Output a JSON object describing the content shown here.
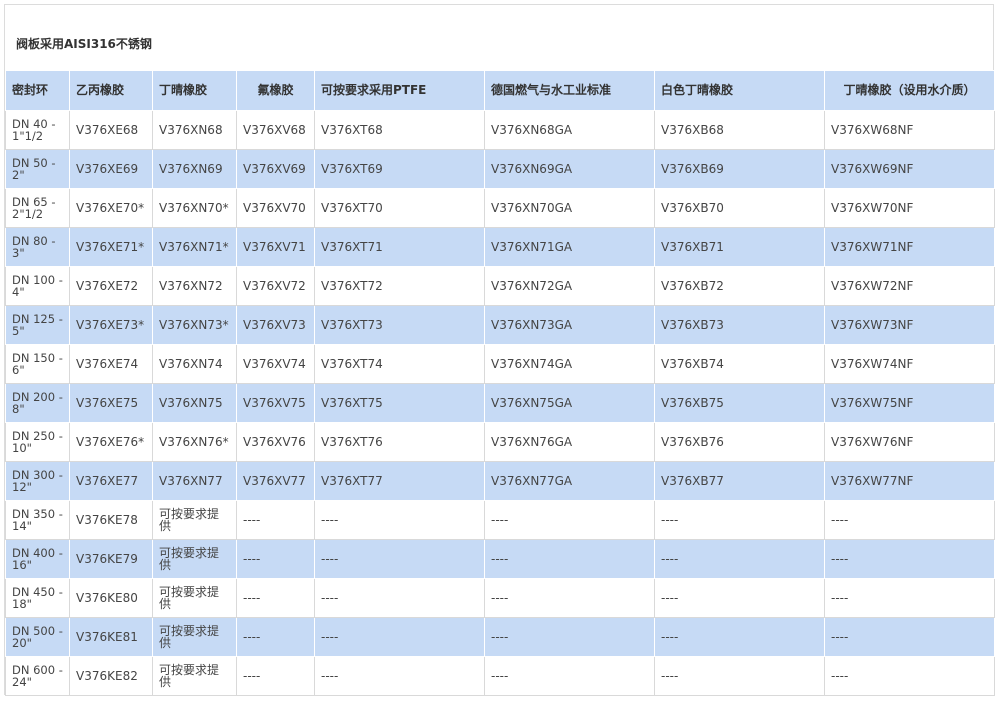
{
  "caption": "阀板采用AISI316不锈钢",
  "table": {
    "headers": [
      "密封环",
      "乙丙橡胶",
      "丁晴橡胶",
      "氟橡胶",
      "可按要求采用PTFE",
      "德国燃气与水工业标准",
      "白色丁晴橡胶",
      "丁晴橡胶（设用水介质）"
    ],
    "rows": [
      [
        "DN 40 - 1\"1/2",
        "V376XE68",
        "V376XN68",
        "V376XV68",
        "V376XT68",
        "V376XN68GA",
        "V376XB68",
        "V376XW68NF"
      ],
      [
        "DN 50 - 2\"",
        "V376XE69",
        "V376XN69",
        "V376XV69",
        "V376XT69",
        "V376XN69GA",
        "V376XB69",
        "V376XW69NF"
      ],
      [
        "DN 65 - 2\"1/2",
        "V376XE70*",
        "V376XN70*",
        "V376XV70",
        "V376XT70",
        "V376XN70GA",
        "V376XB70",
        "V376XW70NF"
      ],
      [
        "DN 80 - 3\"",
        "V376XE71*",
        "V376XN71*",
        "V376XV71",
        "V376XT71",
        "V376XN71GA",
        "V376XB71",
        "V376XW71NF"
      ],
      [
        "DN 100 - 4\"",
        "V376XE72",
        "V376XN72",
        "V376XV72",
        "V376XT72",
        "V376XN72GA",
        "V376XB72",
        "V376XW72NF"
      ],
      [
        "DN 125 - 5\"",
        "V376XE73*",
        "V376XN73*",
        "V376XV73",
        "V376XT73",
        "V376XN73GA",
        "V376XB73",
        "V376XW73NF"
      ],
      [
        "DN 150 - 6\"",
        "V376XE74",
        "V376XN74",
        "V376XV74",
        "V376XT74",
        "V376XN74GA",
        "V376XB74",
        "V376XW74NF"
      ],
      [
        "DN 200 - 8\"",
        "V376XE75",
        "V376XN75",
        "V376XV75",
        "V376XT75",
        "V376XN75GA",
        "V376XB75",
        "V376XW75NF"
      ],
      [
        "DN 250 - 10\"",
        "V376XE76*",
        "V376XN76*",
        "V376XV76",
        "V376XT76",
        "V376XN76GA",
        "V376XB76",
        "V376XW76NF"
      ],
      [
        "DN 300 - 12\"",
        "V376XE77",
        "V376XN77",
        "V376XV77",
        "V376XT77",
        "V376XN77GA",
        "V376XB77",
        "V376XW77NF"
      ],
      [
        "DN 350 - 14\"",
        "V376KE78",
        "可按要求提供",
        "----",
        "----",
        "----",
        "----",
        "----"
      ],
      [
        "DN 400 - 16\"",
        "V376KE79",
        "可按要求提供",
        "----",
        "----",
        "----",
        "----",
        "----"
      ],
      [
        "DN 450 - 18\"",
        "V376KE80",
        "可按要求提供",
        "----",
        "----",
        "----",
        "----",
        "----"
      ],
      [
        "DN 500 - 20\"",
        "V376KE81",
        "可按要求提供",
        "----",
        "----",
        "----",
        "----",
        "----"
      ],
      [
        "DN 600 - 24\"",
        "V376KE82",
        "可按要求提供",
        "----",
        "----",
        "----",
        "----",
        "----"
      ]
    ]
  }
}
